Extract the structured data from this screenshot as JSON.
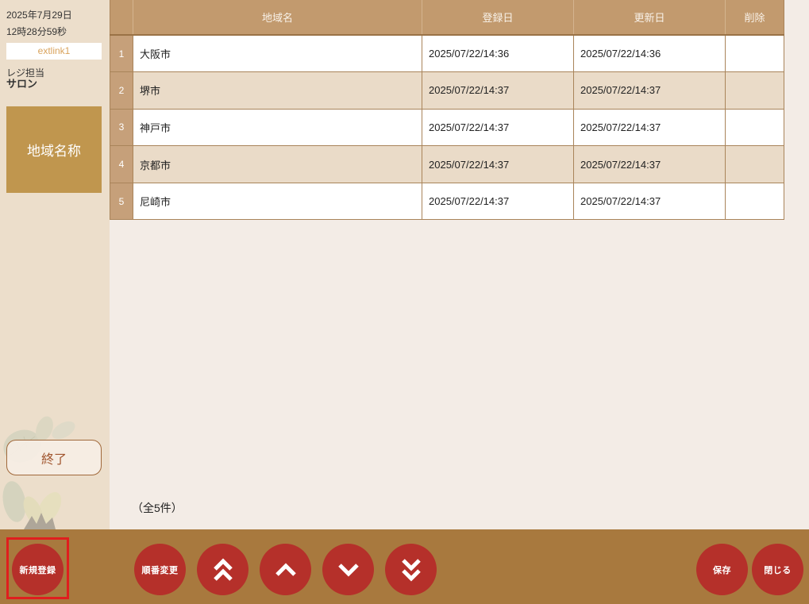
{
  "sidebar": {
    "date": "2025年7月29日",
    "time": "12時28分59秒",
    "terminal": "extlink1",
    "staff_label": "レジ担当",
    "staff_name": "サロン",
    "menu_item": "地域名称",
    "exit_label": "終了"
  },
  "table": {
    "headers": {
      "name": "地域名",
      "registered": "登録日",
      "updated": "更新日",
      "delete": "削除"
    },
    "rows": [
      {
        "no": "1",
        "name": "大阪市",
        "registered": "2025/07/22/14:36",
        "updated": "2025/07/22/14:36"
      },
      {
        "no": "2",
        "name": "堺市",
        "registered": "2025/07/22/14:37",
        "updated": "2025/07/22/14:37"
      },
      {
        "no": "3",
        "name": "神戸市",
        "registered": "2025/07/22/14:37",
        "updated": "2025/07/22/14:37"
      },
      {
        "no": "4",
        "name": "京都市",
        "registered": "2025/07/22/14:37",
        "updated": "2025/07/22/14:37"
      },
      {
        "no": "5",
        "name": "尼崎市",
        "registered": "2025/07/22/14:37",
        "updated": "2025/07/22/14:37"
      }
    ]
  },
  "count_text": "（全5件）",
  "toolbar": {
    "new_label": "新規登録",
    "reorder_label": "順番変更",
    "save_label": "保存",
    "close_label": "閉じる",
    "icons": {
      "move_top": "double-chevron-up-icon",
      "move_up": "chevron-up-icon",
      "move_down": "chevron-down-icon",
      "move_bottom": "double-chevron-down-icon"
    }
  },
  "colors": {
    "sidebar_bg": "#ecdecb",
    "main_bg": "#f3ece6",
    "header_bg": "#c29a6e",
    "index_bg": "#c6a07a",
    "alt_row_bg": "#eadbc8",
    "accent_tan": "#c0964e",
    "toolbar_bg": "#a8793e",
    "button_red": "#b5302a",
    "highlight_red": "#e01e1e",
    "terminal_text": "#d9a35c"
  }
}
